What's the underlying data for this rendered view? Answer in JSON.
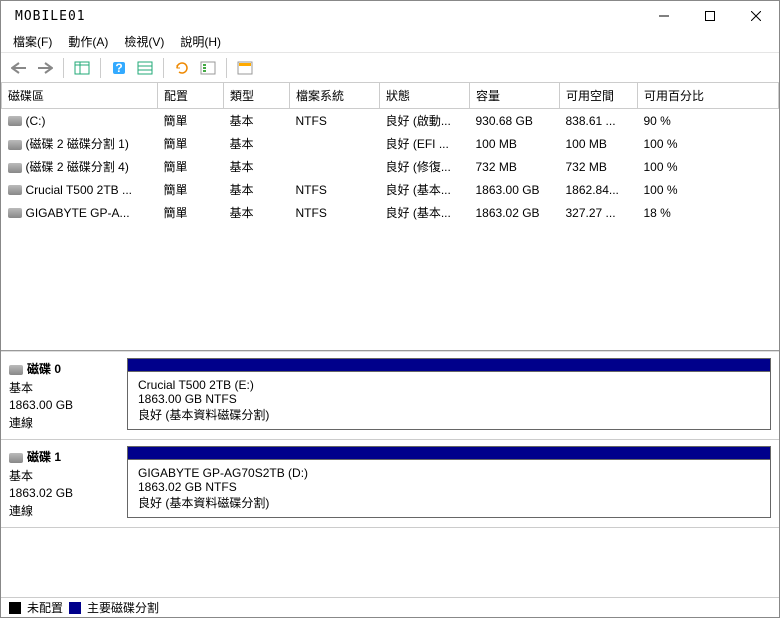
{
  "logo": "MOBILE01",
  "menu": {
    "file": "檔案(F)",
    "action": "動作(A)",
    "view": "檢視(V)",
    "help": "說明(H)"
  },
  "columns": {
    "volume": "磁碟區",
    "layout": "配置",
    "type": "類型",
    "fs": "檔案系統",
    "status": "狀態",
    "capacity": "容量",
    "free": "可用空間",
    "pct": "可用百分比"
  },
  "volumes": [
    {
      "name": "(C:)",
      "layout": "簡單",
      "type": "基本",
      "fs": "NTFS",
      "status": "良好 (啟動...",
      "capacity": "930.68 GB",
      "free": "838.61 ...",
      "pct": "90 %"
    },
    {
      "name": "(磁碟 2 磁碟分割 1)",
      "layout": "簡單",
      "type": "基本",
      "fs": "",
      "status": "良好 (EFI ...",
      "capacity": "100 MB",
      "free": "100 MB",
      "pct": "100 %"
    },
    {
      "name": "(磁碟 2 磁碟分割 4)",
      "layout": "簡單",
      "type": "基本",
      "fs": "",
      "status": "良好 (修復...",
      "capacity": "732 MB",
      "free": "732 MB",
      "pct": "100 %"
    },
    {
      "name": "Crucial T500 2TB ...",
      "layout": "簡單",
      "type": "基本",
      "fs": "NTFS",
      "status": "良好 (基本...",
      "capacity": "1863.00 GB",
      "free": "1862.84...",
      "pct": "100 %"
    },
    {
      "name": "GIGABYTE GP-A...",
      "layout": "簡單",
      "type": "基本",
      "fs": "NTFS",
      "status": "良好 (基本...",
      "capacity": "1863.02 GB",
      "free": "327.27 ...",
      "pct": "18 %"
    }
  ],
  "disks": [
    {
      "title": "磁碟 0",
      "type": "基本",
      "size": "1863.00 GB",
      "state": "連線",
      "pname": "Crucial T500 2TB  (E:)",
      "pl2": "1863.00 GB NTFS",
      "pl3": "良好 (基本資料磁碟分割)"
    },
    {
      "title": "磁碟 1",
      "type": "基本",
      "size": "1863.02 GB",
      "state": "連線",
      "pname": "GIGABYTE GP-AG70S2TB  (D:)",
      "pl2": "1863.02 GB NTFS",
      "pl3": "良好 (基本資料磁碟分割)"
    }
  ],
  "legend": {
    "un": "未配置",
    "pr": "主要磁碟分割"
  }
}
